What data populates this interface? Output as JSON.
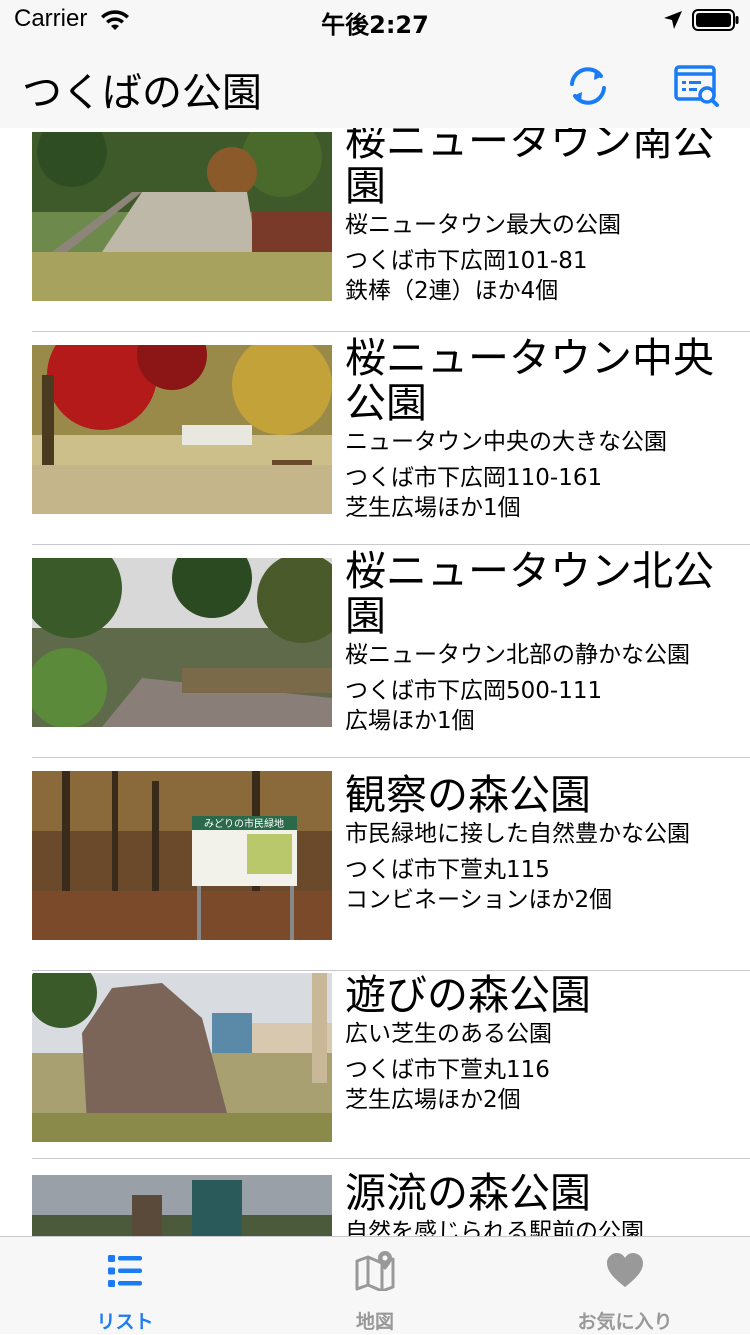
{
  "status": {
    "carrier": "Carrier",
    "time": "午後2:27"
  },
  "nav": {
    "title": "つくばの公園"
  },
  "parks": [
    {
      "name": "桜ニュータウン南公園",
      "desc": "桜ニュータウン最大の公園",
      "address": "つくば市下広岡101-81",
      "equipment": "鉄棒（2連）ほか4個"
    },
    {
      "name": "桜ニュータウン中央公園",
      "desc": "ニュータウン中央の大きな公園",
      "address": "つくば市下広岡110-161",
      "equipment": "芝生広場ほか1個"
    },
    {
      "name": "桜ニュータウン北公園",
      "desc": "桜ニュータウン北部の静かな公園",
      "address": "つくば市下広岡500-111",
      "equipment": "広場ほか1個"
    },
    {
      "name": "観察の森公園",
      "desc": "市民緑地に接した自然豊かな公園",
      "address": "つくば市下萱丸115",
      "equipment": "コンビネーションほか2個"
    },
    {
      "name": "遊びの森公園",
      "desc": "広い芝生のある公園",
      "address": "つくば市下萱丸116",
      "equipment": "芝生広場ほか2個"
    },
    {
      "name": "源流の森公園",
      "desc": "自然を感じられる駅前の公園",
      "address": "",
      "equipment": ""
    }
  ],
  "photo_sign": {
    "title": "みどりの市民緑地"
  },
  "tabs": [
    {
      "label": "リスト",
      "icon": "list-icon",
      "selected": true
    },
    {
      "label": "地図",
      "icon": "map-icon",
      "selected": false
    },
    {
      "label": "お気に入り",
      "icon": "heart-icon",
      "selected": false
    }
  ],
  "colors": {
    "accent": "#1a7cf5",
    "inactive": "#999999",
    "separator": "#c8c7cc",
    "bar": "#f7f7f7"
  }
}
